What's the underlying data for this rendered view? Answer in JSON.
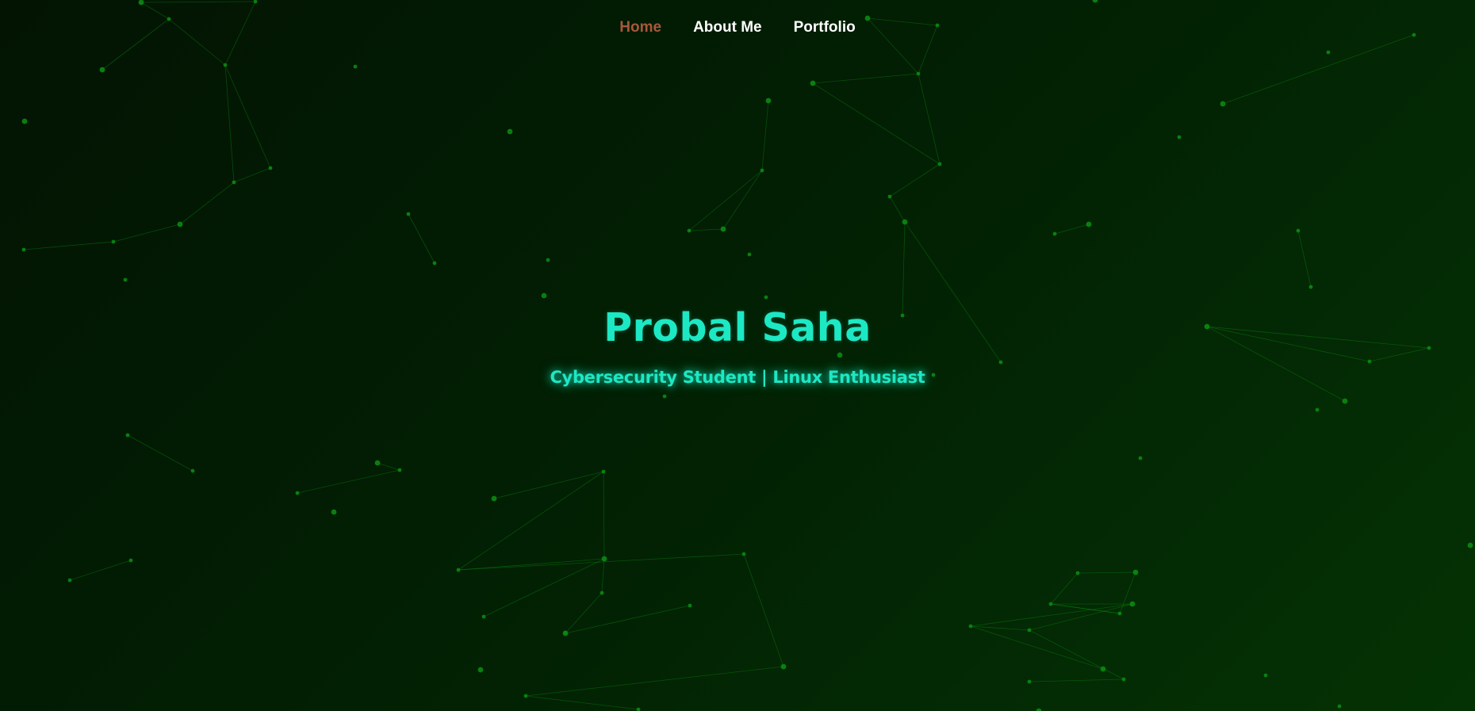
{
  "nav": {
    "items": [
      {
        "label": "Home",
        "active": true
      },
      {
        "label": "About Me",
        "active": false
      },
      {
        "label": "Portfolio",
        "active": false
      }
    ]
  },
  "hero": {
    "title": "Probal Saha",
    "subtitle": "Cybersecurity Student | Linux Enthusiast"
  },
  "colors": {
    "background_dark": "#031403",
    "background_light": "#043204",
    "accent": "#1de8c4",
    "nav_active": "#a8573a",
    "nav_text": "#ffffff",
    "particle": "#0b8a12"
  }
}
